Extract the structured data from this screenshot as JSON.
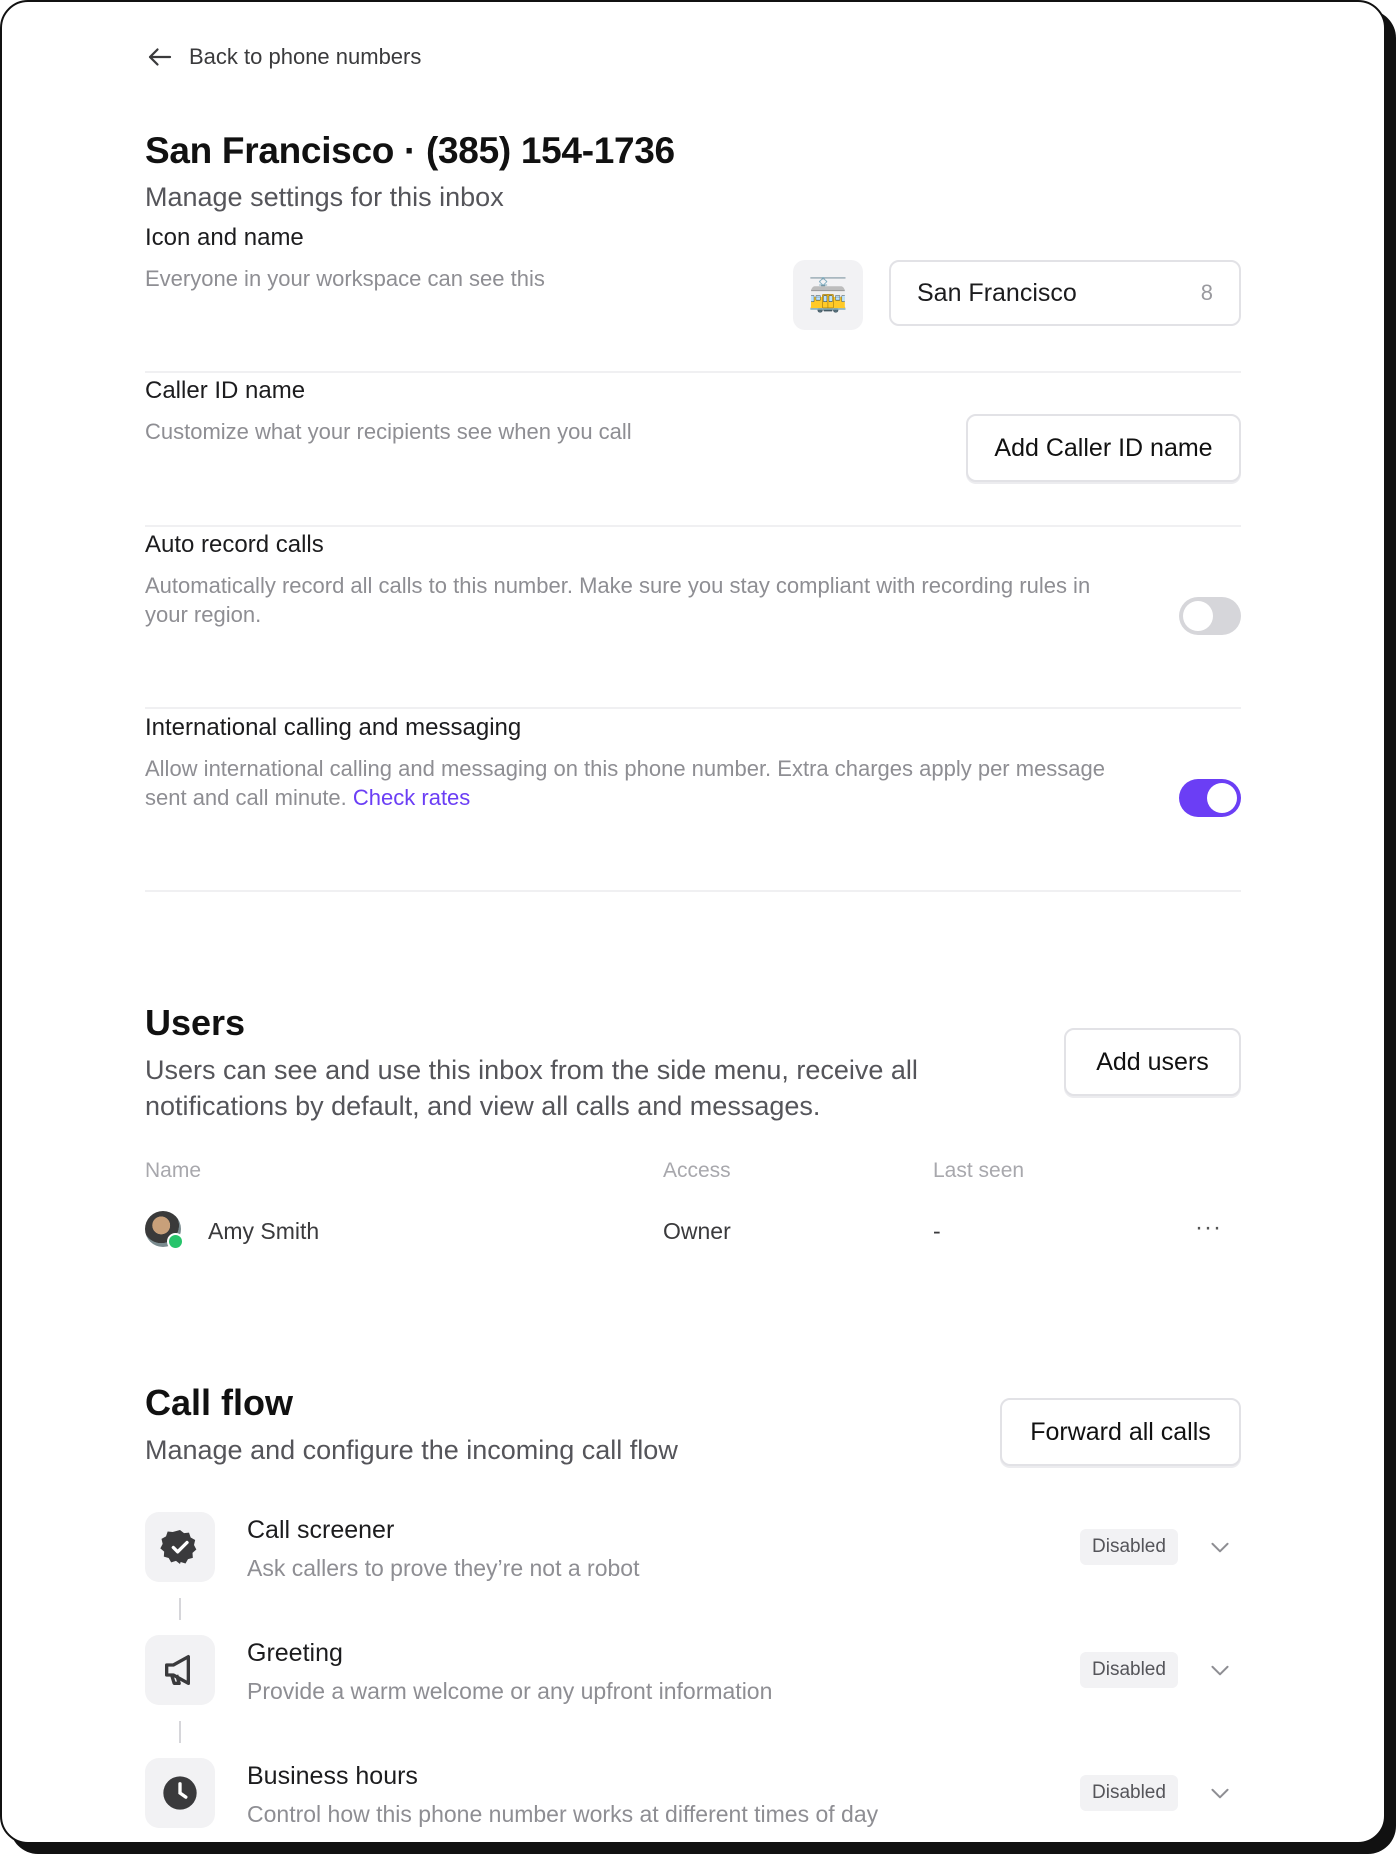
{
  "nav": {
    "back_label": "Back to phone numbers"
  },
  "header": {
    "title": "San Francisco · (385) 154-1736",
    "subtitle": "Manage settings for this inbox"
  },
  "settings": {
    "icon_name": {
      "title": "Icon and name",
      "desc": "Everyone in your workspace can see this",
      "emoji": "🚋",
      "name_value": "San Francisco",
      "char_count": "8"
    },
    "caller_id": {
      "title": "Caller ID name",
      "desc": "Customize what your recipients see when you call",
      "button": "Add Caller ID name"
    },
    "auto_record": {
      "title": "Auto record calls",
      "desc": "Automatically record all calls to this number. Make sure you stay compliant with recording rules in your region.",
      "enabled": false
    },
    "international": {
      "title": "International calling and messaging",
      "desc": "Allow international calling and messaging on this phone number. Extra charges apply per message sent and call minute.",
      "link": "Check rates",
      "enabled": true
    }
  },
  "users": {
    "title": "Users",
    "desc": "Users can see and use this inbox from the side menu, receive all notifications by default, and view all calls and messages.",
    "button": "Add users",
    "columns": [
      "Name",
      "Access",
      "Last seen"
    ],
    "rows": [
      {
        "name": "Amy Smith",
        "access": "Owner",
        "last_seen": "-",
        "more": "···"
      }
    ]
  },
  "call_flow": {
    "title": "Call flow",
    "desc": "Manage and configure the incoming call flow",
    "button": "Forward all calls",
    "steps": [
      {
        "icon": "verified-badge-icon",
        "title": "Call screener",
        "desc": "Ask callers to prove they’re not a robot",
        "status": "Disabled"
      },
      {
        "icon": "megaphone-icon",
        "title": "Greeting",
        "desc": "Provide a warm welcome or any upfront information",
        "status": "Disabled"
      },
      {
        "icon": "clock-icon",
        "title": "Business hours",
        "desc": "Control how this phone number works at different times of day",
        "status": "Disabled"
      }
    ]
  },
  "colors": {
    "accent": "#6b3ef5",
    "toggle_off": "#d6d6da",
    "online": "#27c46b"
  }
}
